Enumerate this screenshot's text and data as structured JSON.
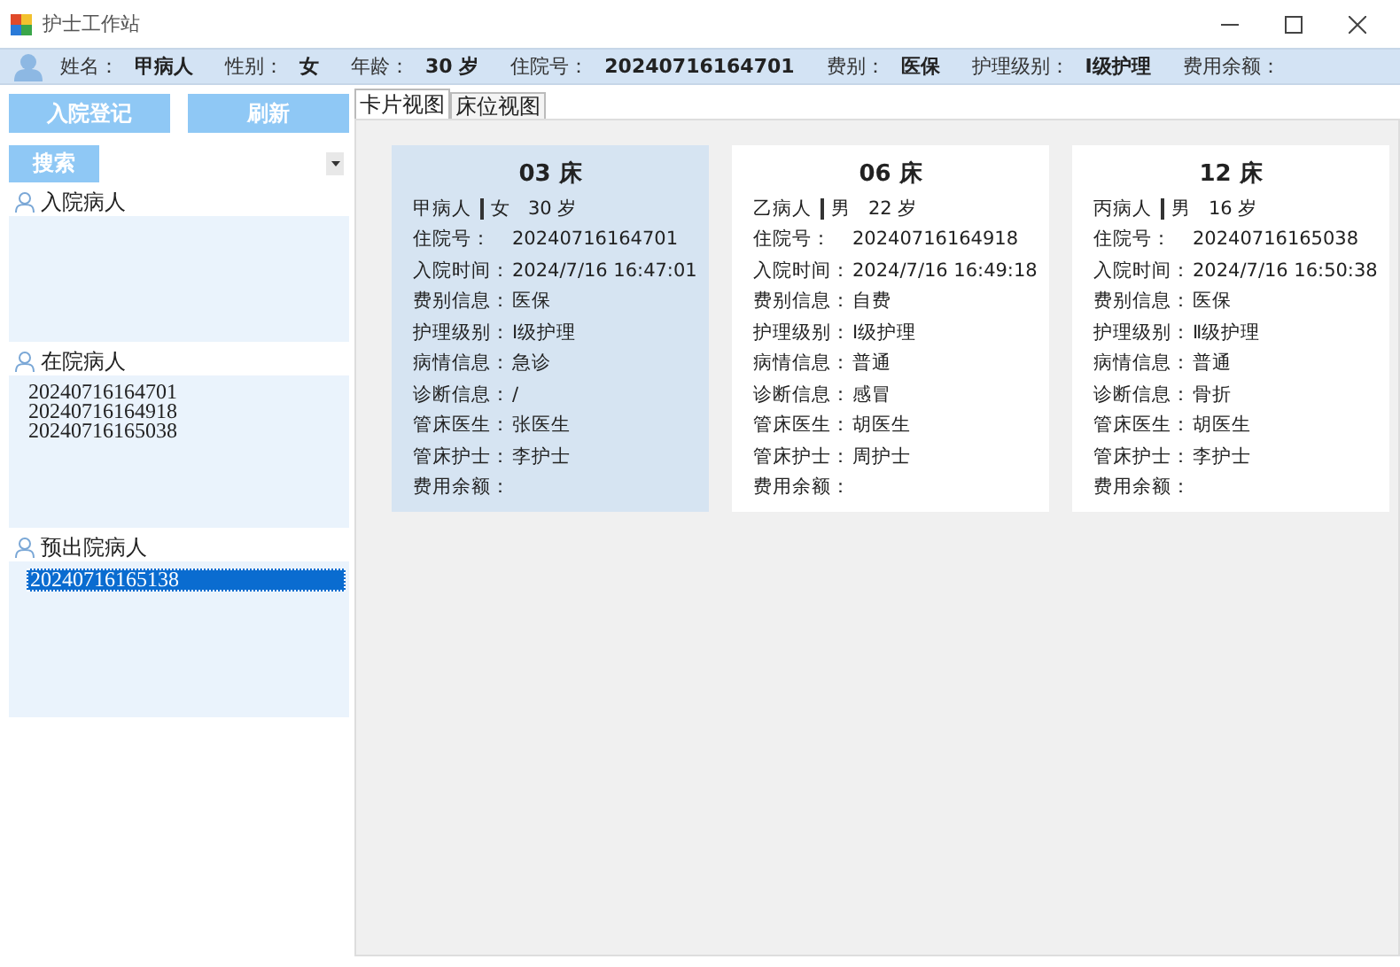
{
  "window": {
    "title": "护士工作站"
  },
  "patient_bar": [
    {
      "label": "姓名：",
      "value": "甲病人"
    },
    {
      "label": "性别：",
      "value": "女"
    },
    {
      "label": "年龄：",
      "value": "30 岁"
    },
    {
      "label": "住院号：",
      "value": "20240716164701"
    },
    {
      "label": "费别：",
      "value": "医保"
    },
    {
      "label": "护理级别：",
      "value": "Ⅰ级护理"
    },
    {
      "label": "费用余额："
    }
  ],
  "sidebar": {
    "buttons": [
      "入院登记",
      "刷新"
    ],
    "search_button": "搜索",
    "groups": [
      {
        "title": "入院病人"
      },
      {
        "title": "在院病人",
        "items": [
          {
            "text": "20240716164701",
            "selected": false
          },
          {
            "text": "20240716164918",
            "selected": false
          },
          {
            "text": "20240716165038",
            "selected": false
          }
        ]
      },
      {
        "title": "预出院病人",
        "items": [
          {
            "text": "20240716165138",
            "selected": true
          }
        ]
      }
    ]
  },
  "tabs": [
    {
      "label": "卡片视图",
      "selected": true
    },
    {
      "label": "床位视图",
      "selected": false
    }
  ],
  "cards": [
    {
      "bed": "03 床",
      "selected": true,
      "name": "甲病人",
      "gender": "女",
      "age": "30 岁",
      "fields": [
        {
          "label": "住院号：",
          "value": "20240716164701"
        },
        {
          "label": "入院时间：",
          "value": "2024/7/16 16:47:01"
        },
        {
          "label": "费别信息：",
          "value": "医保"
        },
        {
          "label": "护理级别：",
          "value": "Ⅰ级护理"
        },
        {
          "label": "病情信息：",
          "value": "急诊"
        },
        {
          "label": "诊断信息：",
          "value": "/"
        },
        {
          "label": "管床医生：",
          "value": "张医生"
        },
        {
          "label": "管床护士：",
          "value": "李护士"
        },
        {
          "label": "费用余额："
        }
      ]
    },
    {
      "bed": "06 床",
      "selected": false,
      "name": "乙病人",
      "gender": "男",
      "age": "22 岁",
      "fields": [
        {
          "label": "住院号：",
          "value": "20240716164918"
        },
        {
          "label": "入院时间：",
          "value": "2024/7/16 16:49:18"
        },
        {
          "label": "费别信息：",
          "value": "自费"
        },
        {
          "label": "护理级别：",
          "value": "Ⅰ级护理"
        },
        {
          "label": "病情信息：",
          "value": "普通"
        },
        {
          "label": "诊断信息：",
          "value": "感冒"
        },
        {
          "label": "管床医生：",
          "value": "胡医生"
        },
        {
          "label": "管床护士：",
          "value": "周护士"
        },
        {
          "label": "费用余额："
        }
      ]
    },
    {
      "bed": "12 床",
      "selected": false,
      "name": "丙病人",
      "gender": "男",
      "age": "16 岁",
      "fields": [
        {
          "label": "住院号：",
          "value": "20240716165038"
        },
        {
          "label": "入院时间：",
          "value": "2024/7/16 16:50:38"
        },
        {
          "label": "费别信息：",
          "value": "医保"
        },
        {
          "label": "护理级别：",
          "value": "Ⅱ级护理"
        },
        {
          "label": "病情信息：",
          "value": "普通"
        },
        {
          "label": "诊断信息：",
          "value": "骨折"
        },
        {
          "label": "管床医生：",
          "value": "胡医生"
        },
        {
          "label": "管床护士：",
          "value": "李护士"
        },
        {
          "label": "费用余额："
        }
      ]
    }
  ]
}
